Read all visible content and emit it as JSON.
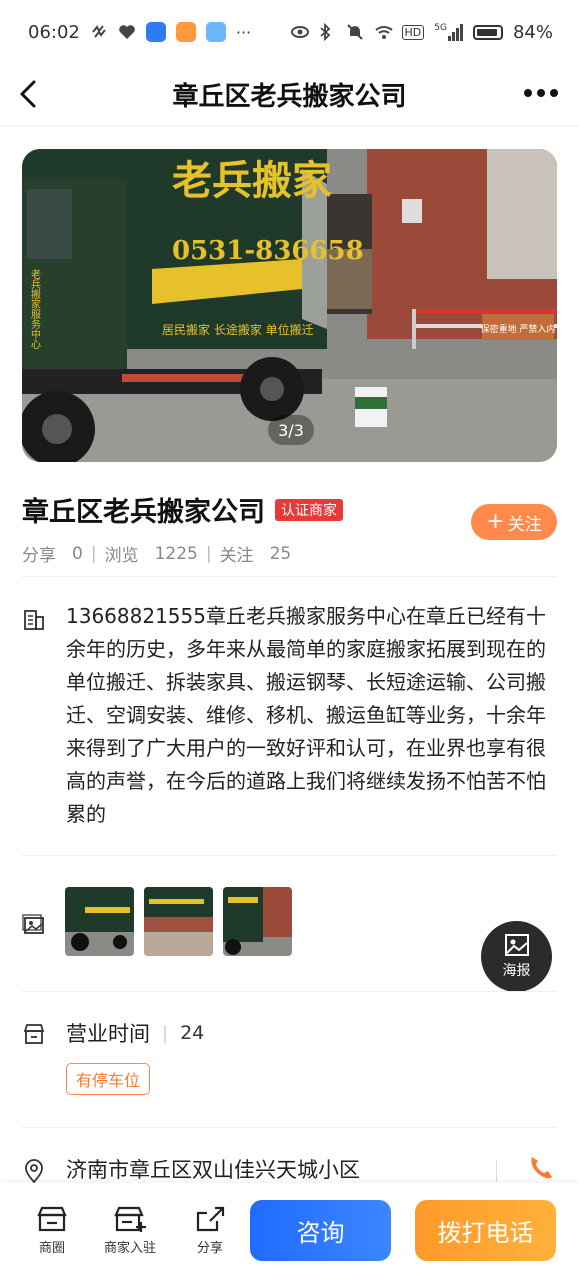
{
  "status_bar": {
    "time": "06:02",
    "battery": "84%",
    "network": "5G",
    "hd": "HD"
  },
  "nav": {
    "title": "章丘区老兵搬家公司"
  },
  "hero": {
    "counter": "3/3",
    "truck_text": "老兵搬家",
    "truck_phone": "0531-836658",
    "truck_services": "居民搬家  长途搬家  单位搬迁",
    "truck_side": "老兵搬家服务中心",
    "sign_text": "保密重地 严禁入内"
  },
  "company": {
    "name": "章丘区老兵搬家公司",
    "cert_badge": "认证商家",
    "share_label": "分享",
    "share_count": "0",
    "views_label": "浏览",
    "views_count": "1225",
    "follow_label": "关注",
    "follow_count": "25",
    "follow_button": "关注"
  },
  "description": "13668821555章丘老兵搬家服务中心在章丘已经有十余年的历史，多年来从最简单的家庭搬家拓展到现在的单位搬迁、拆装家具、搬运钢琴、长短途运输、公司搬迁、空调安装、维修、移机、搬运鱼缸等业务，十余年来得到了广大用户的一致好评和认可，在业界也享有很高的声誉，在今后的道路上我们将继续发扬不怕苦不怕累的",
  "poster_label": "海报",
  "hours": {
    "label": "营业时间",
    "value": "24",
    "tag": "有停车位"
  },
  "address": "济南市章丘区双山佳兴天城小区",
  "bottom_bar": {
    "tab1": "商圈",
    "tab2": "商家入驻",
    "tab3": "分享",
    "consult": "咨询",
    "call": "拨打电话"
  },
  "colors": {
    "accent_orange": "#ff8a4c",
    "cert_red": "#e63a3a",
    "consult_blue": "#1f6bff",
    "call_orange": "#ff9a2a"
  }
}
